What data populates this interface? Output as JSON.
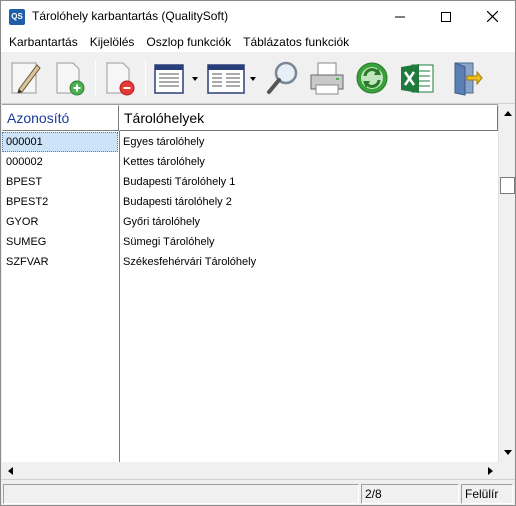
{
  "window": {
    "title": "Tárolóhely karbantartás (QualitySoft)",
    "app_icon_text": "QS"
  },
  "menu": {
    "items": [
      "Karbantartás",
      "Kijelölés",
      "Oszlop funkciók",
      "Táblázatos funkciók"
    ]
  },
  "toolbar": {
    "icons": [
      "edit-icon",
      "new-record-icon",
      "delete-record-icon",
      "column-layout-icon",
      "table-view-icon",
      "search-icon",
      "print-icon",
      "refresh-icon",
      "excel-export-icon",
      "exit-icon"
    ]
  },
  "grid": {
    "headers": {
      "id": "Azonosító",
      "name": "Tárolóhelyek"
    },
    "rows": [
      {
        "id": "000001",
        "name": "Egyes tárolóhely"
      },
      {
        "id": "000002",
        "name": "Kettes tárolóhely"
      },
      {
        "id": "BPEST",
        "name": "Budapesti Tárolóhely 1"
      },
      {
        "id": "BPEST2",
        "name": "Budapesti tárolóhely 2"
      },
      {
        "id": "GYOR",
        "name": "Győri tárolóhely"
      },
      {
        "id": "SUMEG",
        "name": "Sümegi Tárolóhely"
      },
      {
        "id": "SZFVAR",
        "name": "Székesfehérvári Tárolóhely"
      }
    ],
    "selected_index": 0
  },
  "statusbar": {
    "main": "",
    "position": "2/8",
    "mode": "Felülír"
  },
  "colors": {
    "header_id_text": "#1a3a9c",
    "selection": "#cde3f7",
    "excel_green": "#1e7b3c",
    "refresh_green": "#3aa13a"
  }
}
